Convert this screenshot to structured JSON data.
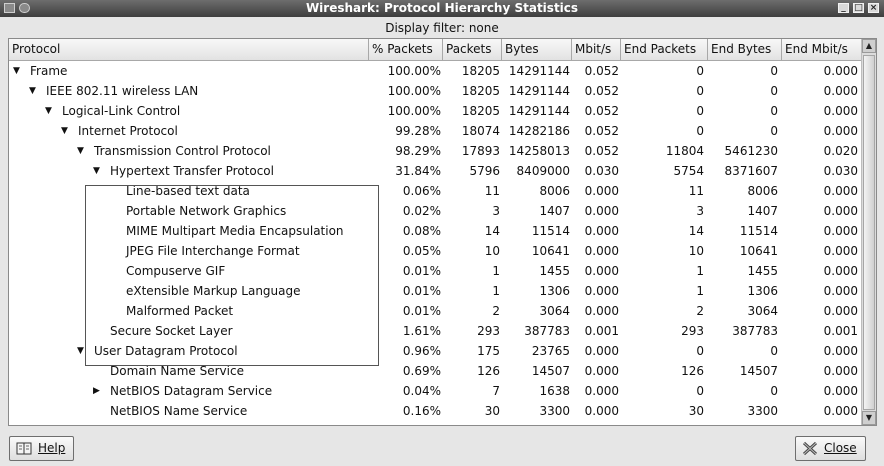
{
  "window": {
    "title": "Wireshark: Protocol Hierarchy Statistics"
  },
  "filter": {
    "text": "Display filter: none"
  },
  "columns": [
    "Protocol",
    "% Packets",
    "Packets",
    "Bytes",
    "Mbit/s",
    "End Packets",
    "End Bytes",
    "End Mbit/s"
  ],
  "rows": [
    {
      "protocol": "Frame",
      "level": 0,
      "expander": "open",
      "pct": "100.00%",
      "packets": "18205",
      "bytes": "14291144",
      "mbit": "0.052",
      "end_packets": "0",
      "end_bytes": "0",
      "end_mbit": "0.000"
    },
    {
      "protocol": "IEEE 802.11 wireless LAN",
      "level": 1,
      "expander": "open",
      "pct": "100.00%",
      "packets": "18205",
      "bytes": "14291144",
      "mbit": "0.052",
      "end_packets": "0",
      "end_bytes": "0",
      "end_mbit": "0.000"
    },
    {
      "protocol": "Logical-Link Control",
      "level": 2,
      "expander": "open",
      "pct": "100.00%",
      "packets": "18205",
      "bytes": "14291144",
      "mbit": "0.052",
      "end_packets": "0",
      "end_bytes": "0",
      "end_mbit": "0.000"
    },
    {
      "protocol": "Internet Protocol",
      "level": 3,
      "expander": "open",
      "pct": "99.28%",
      "packets": "18074",
      "bytes": "14282186",
      "mbit": "0.052",
      "end_packets": "0",
      "end_bytes": "0",
      "end_mbit": "0.000"
    },
    {
      "protocol": "Transmission Control Protocol",
      "level": 4,
      "expander": "open",
      "pct": "98.29%",
      "packets": "17893",
      "bytes": "14258013",
      "mbit": "0.052",
      "end_packets": "11804",
      "end_bytes": "5461230",
      "end_mbit": "0.020"
    },
    {
      "protocol": "Hypertext Transfer Protocol",
      "level": 5,
      "expander": "open",
      "pct": "31.84%",
      "packets": "5796",
      "bytes": "8409000",
      "mbit": "0.030",
      "end_packets": "5754",
      "end_bytes": "8371607",
      "end_mbit": "0.030"
    },
    {
      "protocol": "Line-based text data",
      "level": 6,
      "expander": "none",
      "pct": "0.06%",
      "packets": "11",
      "bytes": "8006",
      "mbit": "0.000",
      "end_packets": "11",
      "end_bytes": "8006",
      "end_mbit": "0.000"
    },
    {
      "protocol": "Portable Network Graphics",
      "level": 6,
      "expander": "none",
      "pct": "0.02%",
      "packets": "3",
      "bytes": "1407",
      "mbit": "0.000",
      "end_packets": "3",
      "end_bytes": "1407",
      "end_mbit": "0.000"
    },
    {
      "protocol": "MIME Multipart Media Encapsulation",
      "level": 6,
      "expander": "none",
      "pct": "0.08%",
      "packets": "14",
      "bytes": "11514",
      "mbit": "0.000",
      "end_packets": "14",
      "end_bytes": "11514",
      "end_mbit": "0.000"
    },
    {
      "protocol": "JPEG File Interchange Format",
      "level": 6,
      "expander": "none",
      "pct": "0.05%",
      "packets": "10",
      "bytes": "10641",
      "mbit": "0.000",
      "end_packets": "10",
      "end_bytes": "10641",
      "end_mbit": "0.000"
    },
    {
      "protocol": "Compuserve GIF",
      "level": 6,
      "expander": "none",
      "pct": "0.01%",
      "packets": "1",
      "bytes": "1455",
      "mbit": "0.000",
      "end_packets": "1",
      "end_bytes": "1455",
      "end_mbit": "0.000"
    },
    {
      "protocol": "eXtensible Markup Language",
      "level": 6,
      "expander": "none",
      "pct": "0.01%",
      "packets": "1",
      "bytes": "1306",
      "mbit": "0.000",
      "end_packets": "1",
      "end_bytes": "1306",
      "end_mbit": "0.000"
    },
    {
      "protocol": "Malformed Packet",
      "level": 6,
      "expander": "none",
      "pct": "0.01%",
      "packets": "2",
      "bytes": "3064",
      "mbit": "0.000",
      "end_packets": "2",
      "end_bytes": "3064",
      "end_mbit": "0.000"
    },
    {
      "protocol": "Secure Socket Layer",
      "level": 5,
      "expander": "none",
      "pct": "1.61%",
      "packets": "293",
      "bytes": "387783",
      "mbit": "0.001",
      "end_packets": "293",
      "end_bytes": "387783",
      "end_mbit": "0.001"
    },
    {
      "protocol": "User Datagram Protocol",
      "level": 4,
      "expander": "open",
      "pct": "0.96%",
      "packets": "175",
      "bytes": "23765",
      "mbit": "0.000",
      "end_packets": "0",
      "end_bytes": "0",
      "end_mbit": "0.000"
    },
    {
      "protocol": "Domain Name Service",
      "level": 5,
      "expander": "none",
      "pct": "0.69%",
      "packets": "126",
      "bytes": "14507",
      "mbit": "0.000",
      "end_packets": "126",
      "end_bytes": "14507",
      "end_mbit": "0.000"
    },
    {
      "protocol": "NetBIOS Datagram Service",
      "level": 5,
      "expander": "closed",
      "pct": "0.04%",
      "packets": "7",
      "bytes": "1638",
      "mbit": "0.000",
      "end_packets": "0",
      "end_bytes": "0",
      "end_mbit": "0.000"
    },
    {
      "protocol": "NetBIOS Name Service",
      "level": 5,
      "expander": "none",
      "pct": "0.16%",
      "packets": "30",
      "bytes": "3300",
      "mbit": "0.000",
      "end_packets": "30",
      "end_bytes": "3300",
      "end_mbit": "0.000"
    }
  ],
  "buttons": {
    "help_label": "Help",
    "close_label": "Close"
  }
}
